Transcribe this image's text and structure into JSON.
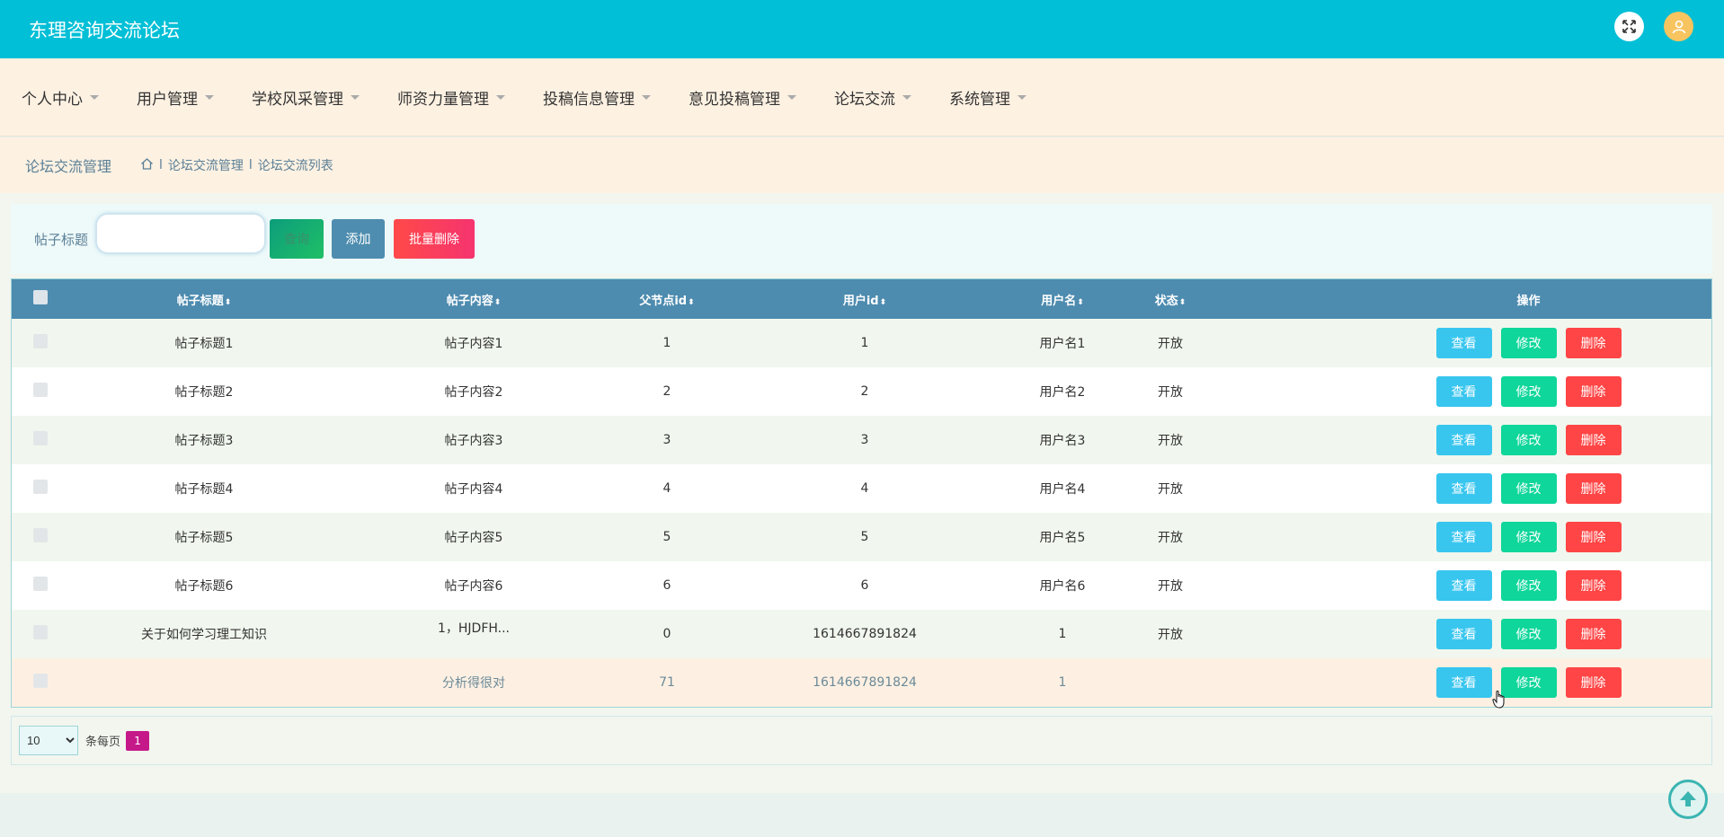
{
  "header": {
    "title": "东理咨询交流论坛",
    "icons": [
      "expand-icon",
      "user-icon"
    ]
  },
  "nav": {
    "items": [
      {
        "label": "个人中心"
      },
      {
        "label": "用户管理"
      },
      {
        "label": "学校风采管理"
      },
      {
        "label": "师资力量管理"
      },
      {
        "label": "投稿信息管理"
      },
      {
        "label": "意见投稿管理"
      },
      {
        "label": "论坛交流"
      },
      {
        "label": "系统管理"
      }
    ]
  },
  "breadcrumb": {
    "title": "论坛交流管理",
    "path": [
      "论坛交流管理",
      "论坛交流列表"
    ],
    "separator": "l"
  },
  "search": {
    "label": "帖子标题",
    "value": "",
    "placeholder": "",
    "search_label": "查询",
    "add_label": "添加",
    "batch_delete_label": "批量删除"
  },
  "table": {
    "columns": [
      "帖子标题",
      "帖子内容",
      "父节点id",
      "用户id",
      "用户名",
      "状态",
      "操作"
    ],
    "sort_symbol": "⬍",
    "row_actions": {
      "view": "查看",
      "edit": "修改",
      "delete": "删除"
    },
    "rows": [
      {
        "title": "帖子标题1",
        "content": "帖子内容1",
        "parentid": "1",
        "userid": "1",
        "username": "用户名1",
        "status": "开放"
      },
      {
        "title": "帖子标题2",
        "content": "帖子内容2",
        "parentid": "2",
        "userid": "2",
        "username": "用户名2",
        "status": "开放"
      },
      {
        "title": "帖子标题3",
        "content": "帖子内容3",
        "parentid": "3",
        "userid": "3",
        "username": "用户名3",
        "status": "开放"
      },
      {
        "title": "帖子标题4",
        "content": "帖子内容4",
        "parentid": "4",
        "userid": "4",
        "username": "用户名4",
        "status": "开放"
      },
      {
        "title": "帖子标题5",
        "content": "帖子内容5",
        "parentid": "5",
        "userid": "5",
        "username": "用户名5",
        "status": "开放"
      },
      {
        "title": "帖子标题6",
        "content": "帖子内容6",
        "parentid": "6",
        "userid": "6",
        "username": "用户名6",
        "status": "开放"
      },
      {
        "title": "关于如何学习理工知识",
        "content": "1，HJDFH...",
        "parentid": "0",
        "userid": "1614667891824",
        "username": "1",
        "status": "开放"
      },
      {
        "title": "",
        "content": "分析得很对",
        "parentid": "71",
        "userid": "1614667891824",
        "username": "1",
        "status": ""
      }
    ]
  },
  "pagination": {
    "page_size": "10",
    "per_page_label": "条每页",
    "current_page": "1"
  },
  "colors": {
    "header": "#00bfd6",
    "nav_bg": "#fdf1e2",
    "table_header": "#4d8baf",
    "view": "#38c6ef",
    "edit": "#0fd69a",
    "delete": "#ff4545",
    "page_active": "#c5198a"
  }
}
